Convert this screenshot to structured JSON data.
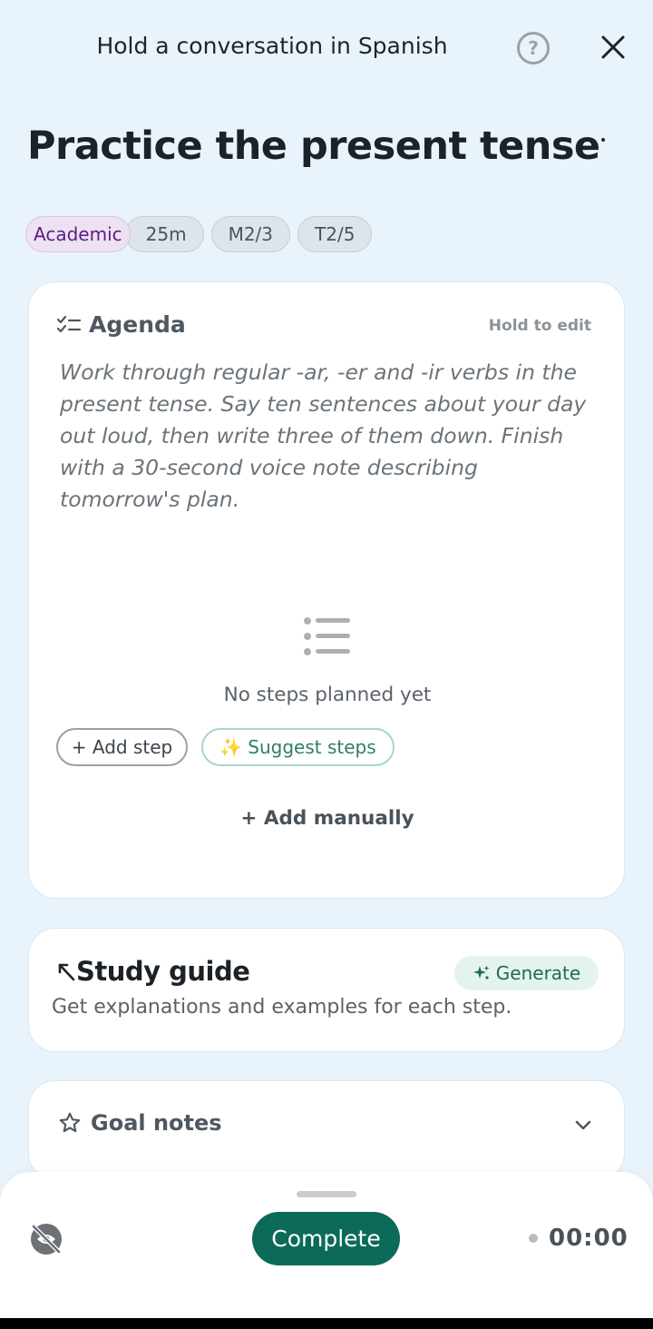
{
  "header": {
    "title": "Hold a conversation in Spanish",
    "help_icon": "?",
    "close_icon": "close-icon"
  },
  "page": {
    "title": "Practice the present tense"
  },
  "chips": [
    {
      "label": "Academic"
    },
    {
      "label": "25m"
    },
    {
      "label": "M2/3"
    },
    {
      "label": "T2/5"
    }
  ],
  "agenda": {
    "label": "Agenda",
    "hold_to_edit": "Hold to edit",
    "description": "Work through regular -ar, -er and -ir verbs in the present tense. Say ten sentences about your day out loud, then write three of them down. Finish with a 30-second voice note describing tomorrow's plan.",
    "empty_text": "No steps planned yet",
    "add_step_label": "+ Add step",
    "suggest_icon": "✨",
    "suggest_label": "Suggest steps",
    "add_manually_label": "+ Add manually"
  },
  "study_guide": {
    "label": "Study guide",
    "subtitle": "Get explanations and examples for each step.",
    "generate_label": "Generate"
  },
  "goal_notes": {
    "label": "Goal notes"
  },
  "bottom_bar": {
    "complete_label": "Complete",
    "timer": "00:00"
  },
  "colors": {
    "background": "#e9f3fb",
    "accent": "#0c6b58",
    "academic_chip_text": "#5e1a86"
  }
}
